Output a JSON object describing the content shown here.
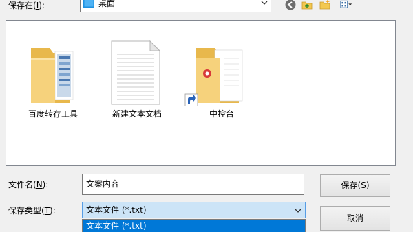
{
  "location": {
    "label_main": "保存在(",
    "label_key": "I",
    "label_end": "):",
    "current_folder": "桌面"
  },
  "files": [
    {
      "name": "百度转存工具"
    },
    {
      "name": "新建文本文档"
    },
    {
      "name": "中控台"
    }
  ],
  "filename": {
    "label_main": "文件名(",
    "label_key": "N",
    "label_end": "):",
    "value": "文案内容"
  },
  "filetype": {
    "label_main": "保存类型(",
    "label_key": "T",
    "label_end": "):",
    "selected": "文本文件 (*.txt)",
    "open_option": "文本文件 (*.txt)"
  },
  "buttons": {
    "save_main": "保存(",
    "save_key": "S",
    "save_end": ")",
    "cancel": "取消"
  },
  "colors": {
    "window_bg": "#f0f0f0",
    "folder": "#f5d27a",
    "accent": "#0078d7",
    "select_bg": "#cce4f7"
  }
}
